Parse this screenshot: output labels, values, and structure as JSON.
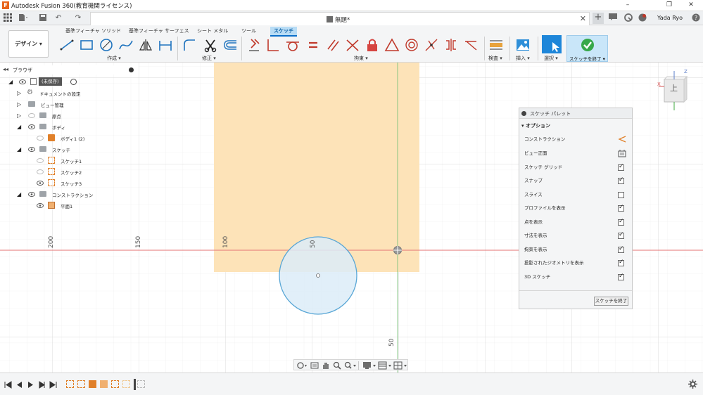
{
  "app": {
    "window_title": "Autodesk Fusion 360(教育機関ライセンス)",
    "document_title": "無題*",
    "user_name": "Yada Ryo"
  },
  "ribbon": {
    "workspace": "デザイン ▾",
    "tabs": [
      {
        "label": "基準フィーチャ ソリッド",
        "active": false
      },
      {
        "label": "基準フィーチャ サーフェス",
        "active": false
      },
      {
        "label": "シート メタル",
        "active": false
      },
      {
        "label": "ツール",
        "active": false
      },
      {
        "label": "スケッチ",
        "active": true
      }
    ],
    "groups": {
      "create": "作成 ▾",
      "modify": "修正 ▾",
      "constraints": "拘束 ▾",
      "inspect": "検査 ▾",
      "insert": "挿入 ▾",
      "select": "選択 ▾",
      "finish": "スケッチを終了 ▾"
    }
  },
  "browser": {
    "title": "ブラウザ",
    "root": "(未保存)",
    "nodes": [
      {
        "label": "ドキュメントの設定",
        "icon": "gear-icon"
      },
      {
        "label": "ビュー管理",
        "icon": "folder-icon"
      },
      {
        "label": "原点",
        "icon": "folder-icon"
      },
      {
        "label": "ボディ",
        "icon": "folder-icon"
      },
      {
        "label": "ボディ1 (2)",
        "icon": "body-icon"
      },
      {
        "label": "スケッチ",
        "icon": "folder-icon"
      },
      {
        "label": "スケッチ1",
        "icon": "sketch-icon"
      },
      {
        "label": "スケッチ2",
        "icon": "sketch-icon"
      },
      {
        "label": "スケッチ3",
        "icon": "sketch-icon"
      },
      {
        "label": "コンストラクション",
        "icon": "folder-icon"
      },
      {
        "label": "平面1",
        "icon": "plane-icon"
      }
    ]
  },
  "canvas": {
    "dimension_labels": [
      "200",
      "150",
      "100",
      "50",
      "50"
    ],
    "viewcube_face": "上",
    "axis_x": "X",
    "axis_z": "Z",
    "colors": {
      "profile_fill": "#fde3b8",
      "circle_fill": "#dcecf8",
      "circle_stroke": "#5aa7d6",
      "x_axis": "#e57373",
      "y_axis": "#7cc27c"
    }
  },
  "palette": {
    "title": "スケッチ パレット",
    "section": "オプション",
    "rows": [
      {
        "label": "コンストラクション",
        "type": "icon",
        "icon": "construction-icon"
      },
      {
        "label": "ビュー正面",
        "type": "icon",
        "icon": "look-at-icon"
      },
      {
        "label": "スケッチ グリッド",
        "type": "check",
        "checked": true
      },
      {
        "label": "スナップ",
        "type": "check",
        "checked": true
      },
      {
        "label": "スライス",
        "type": "check",
        "checked": false
      },
      {
        "label": "プロファイルを表示",
        "type": "check",
        "checked": true
      },
      {
        "label": "点を表示",
        "type": "check",
        "checked": true
      },
      {
        "label": "寸法を表示",
        "type": "check",
        "checked": true
      },
      {
        "label": "拘束を表示",
        "type": "check",
        "checked": true
      },
      {
        "label": "投影されたジオメトリを表示",
        "type": "check",
        "checked": true
      },
      {
        "label": "3D スケッチ",
        "type": "check",
        "checked": true
      }
    ],
    "finish_button": "スケッチを終了"
  }
}
